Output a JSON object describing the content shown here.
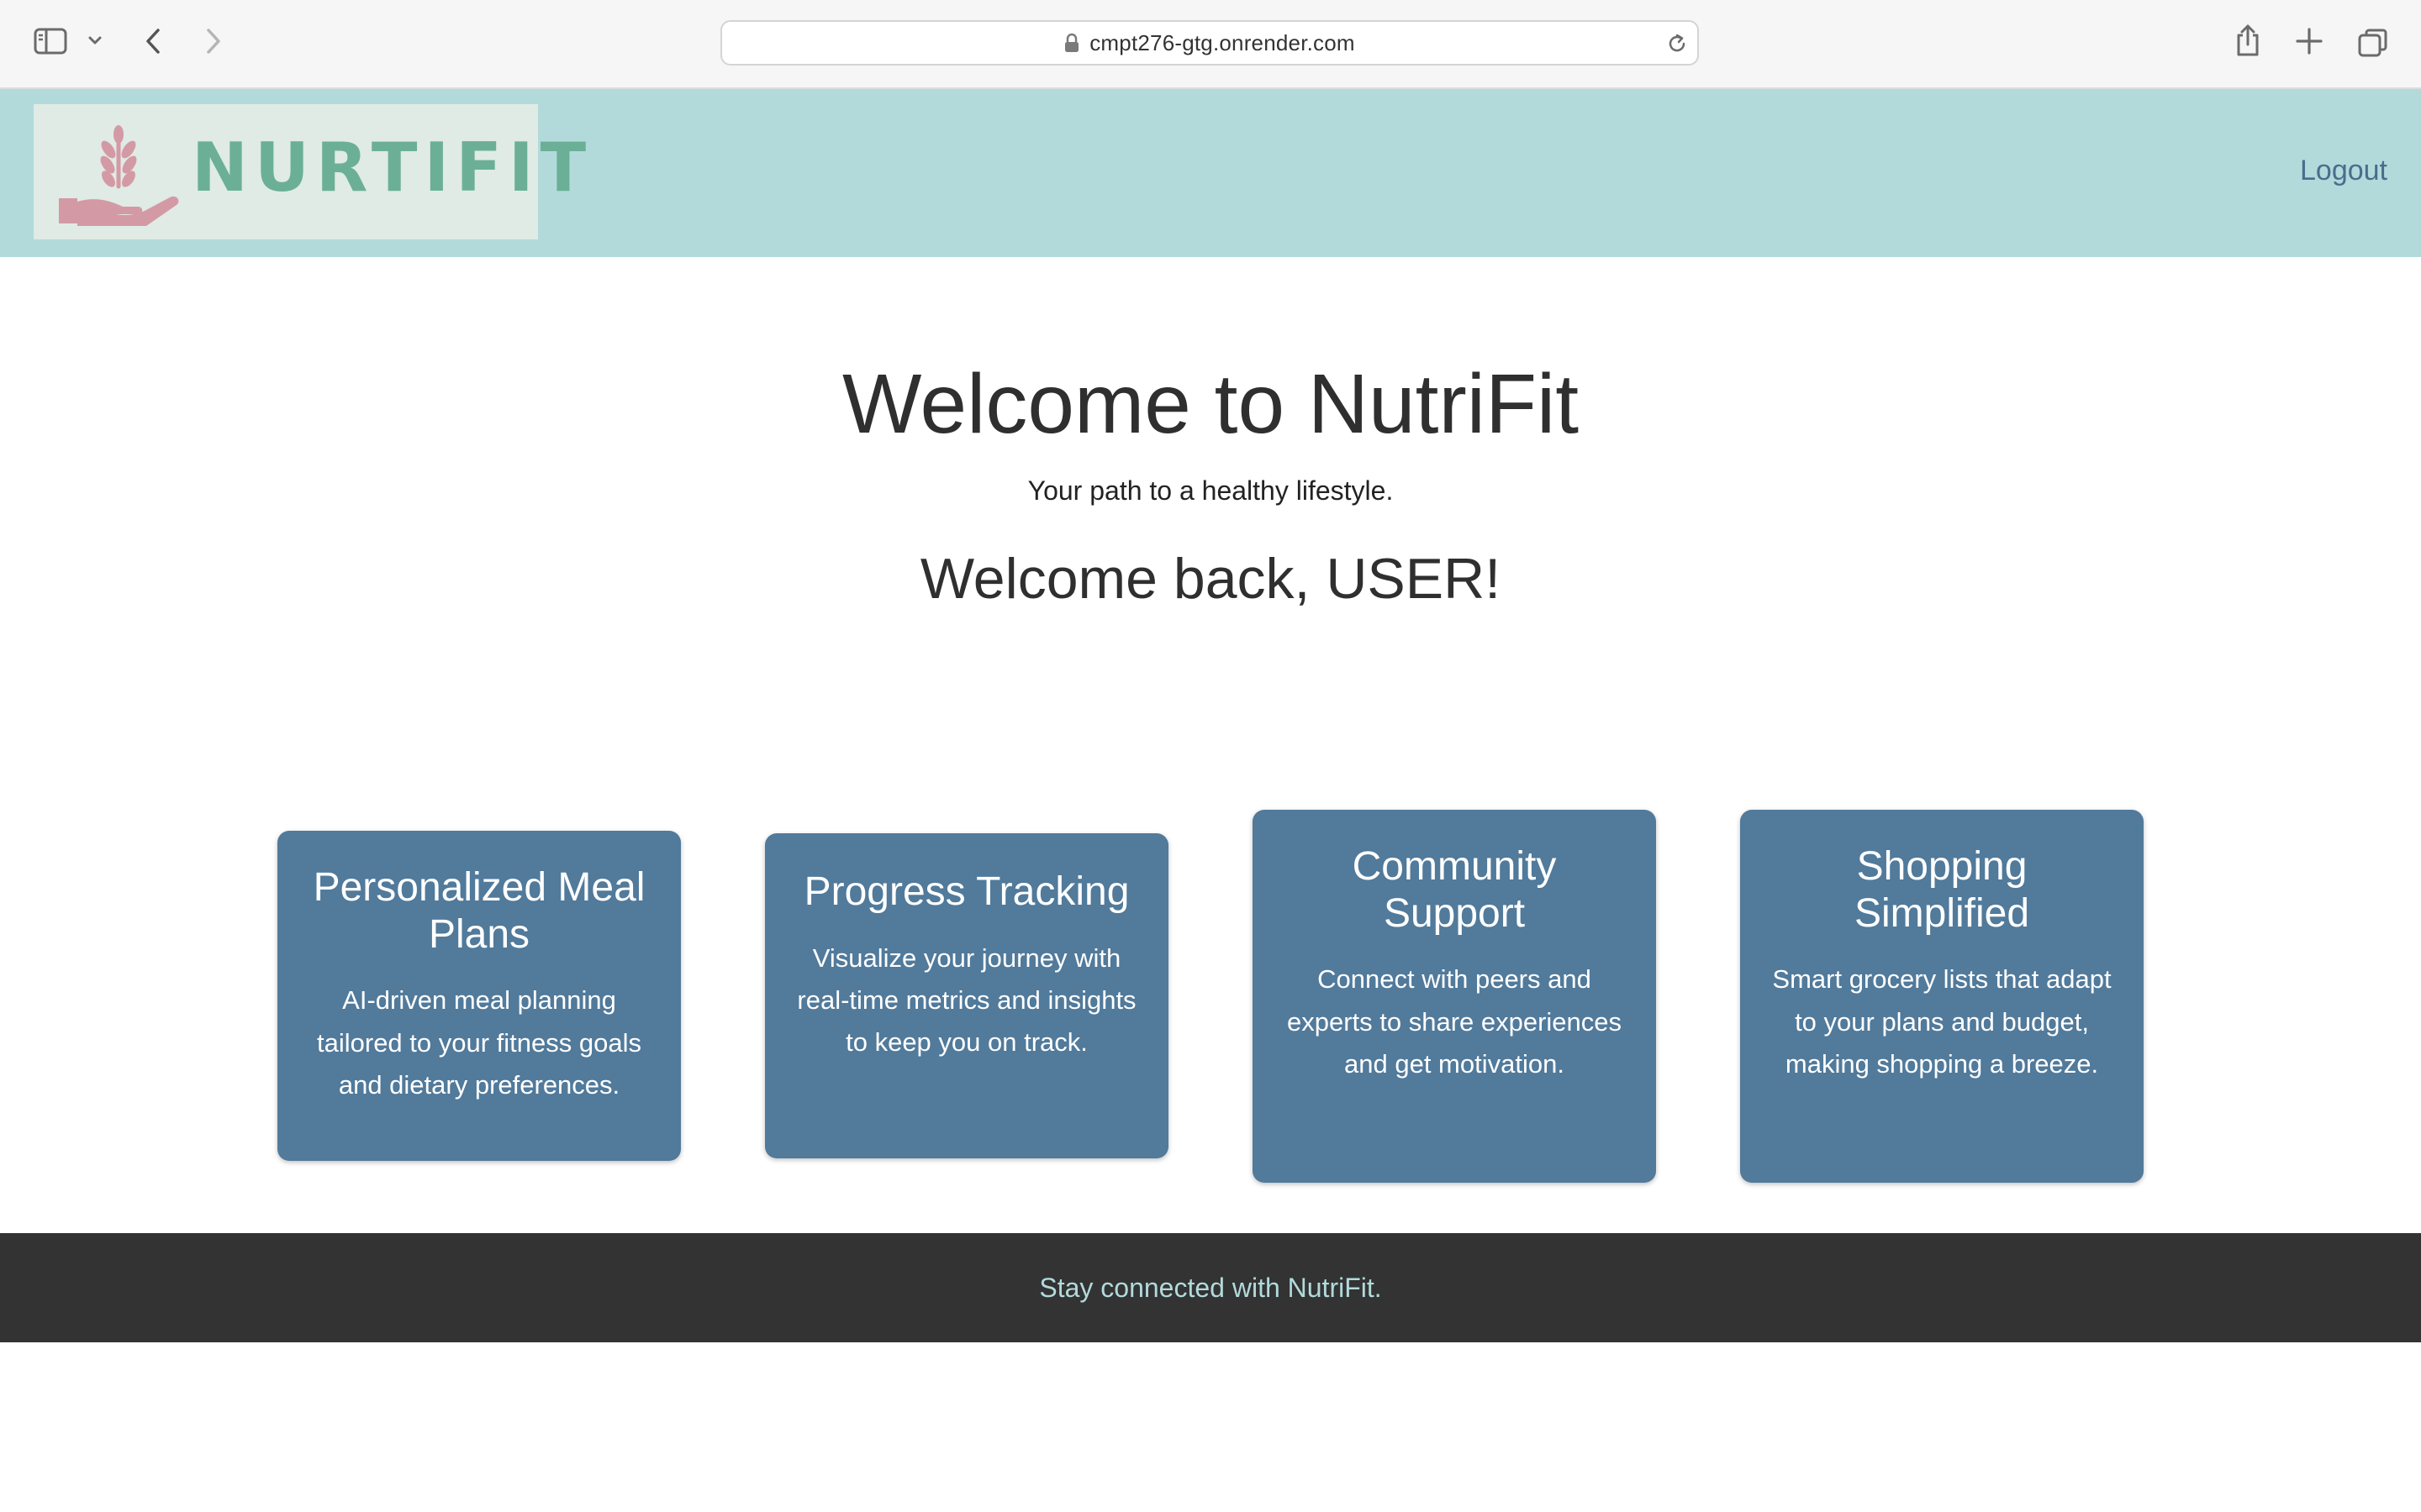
{
  "browser": {
    "url": "cmpt276-gtg.onrender.com",
    "icons": [
      "sidebar-icon",
      "chevron-down-icon",
      "back-icon",
      "forward-icon",
      "lock-icon",
      "reload-icon",
      "share-icon",
      "plus-icon",
      "tabs-icon"
    ]
  },
  "header": {
    "logo_text": "NURTIFIT",
    "logout_label": "Logout",
    "colors": {
      "header_bg": "#b2dadb",
      "logo_bg": "#dfebe4",
      "logo_green": "#6bb096",
      "logo_pink": "#d39aa5",
      "link": "#4a6d8c"
    }
  },
  "hero": {
    "title": "Welcome to NutriFit",
    "subtitle": "Your path to a healthy lifestyle.",
    "welcome_back": "Welcome back, USER!"
  },
  "features": [
    {
      "title": "Personalized Meal Plans",
      "description": "AI-driven meal planning tailored to your fitness goals and dietary preferences."
    },
    {
      "title": "Progress Tracking",
      "description": "Visualize your journey with real-time metrics and insights to keep you on track."
    },
    {
      "title": "Community Support",
      "description": "Connect with peers and experts to share experiences and get motivation."
    },
    {
      "title": "Shopping Simplified",
      "description": "Smart grocery lists that adapt to your plans and budget, making shopping a breeze."
    }
  ],
  "card_color": "#517a9b",
  "footer": {
    "text": "Stay connected with NutriFit.",
    "bg": "#333333"
  }
}
